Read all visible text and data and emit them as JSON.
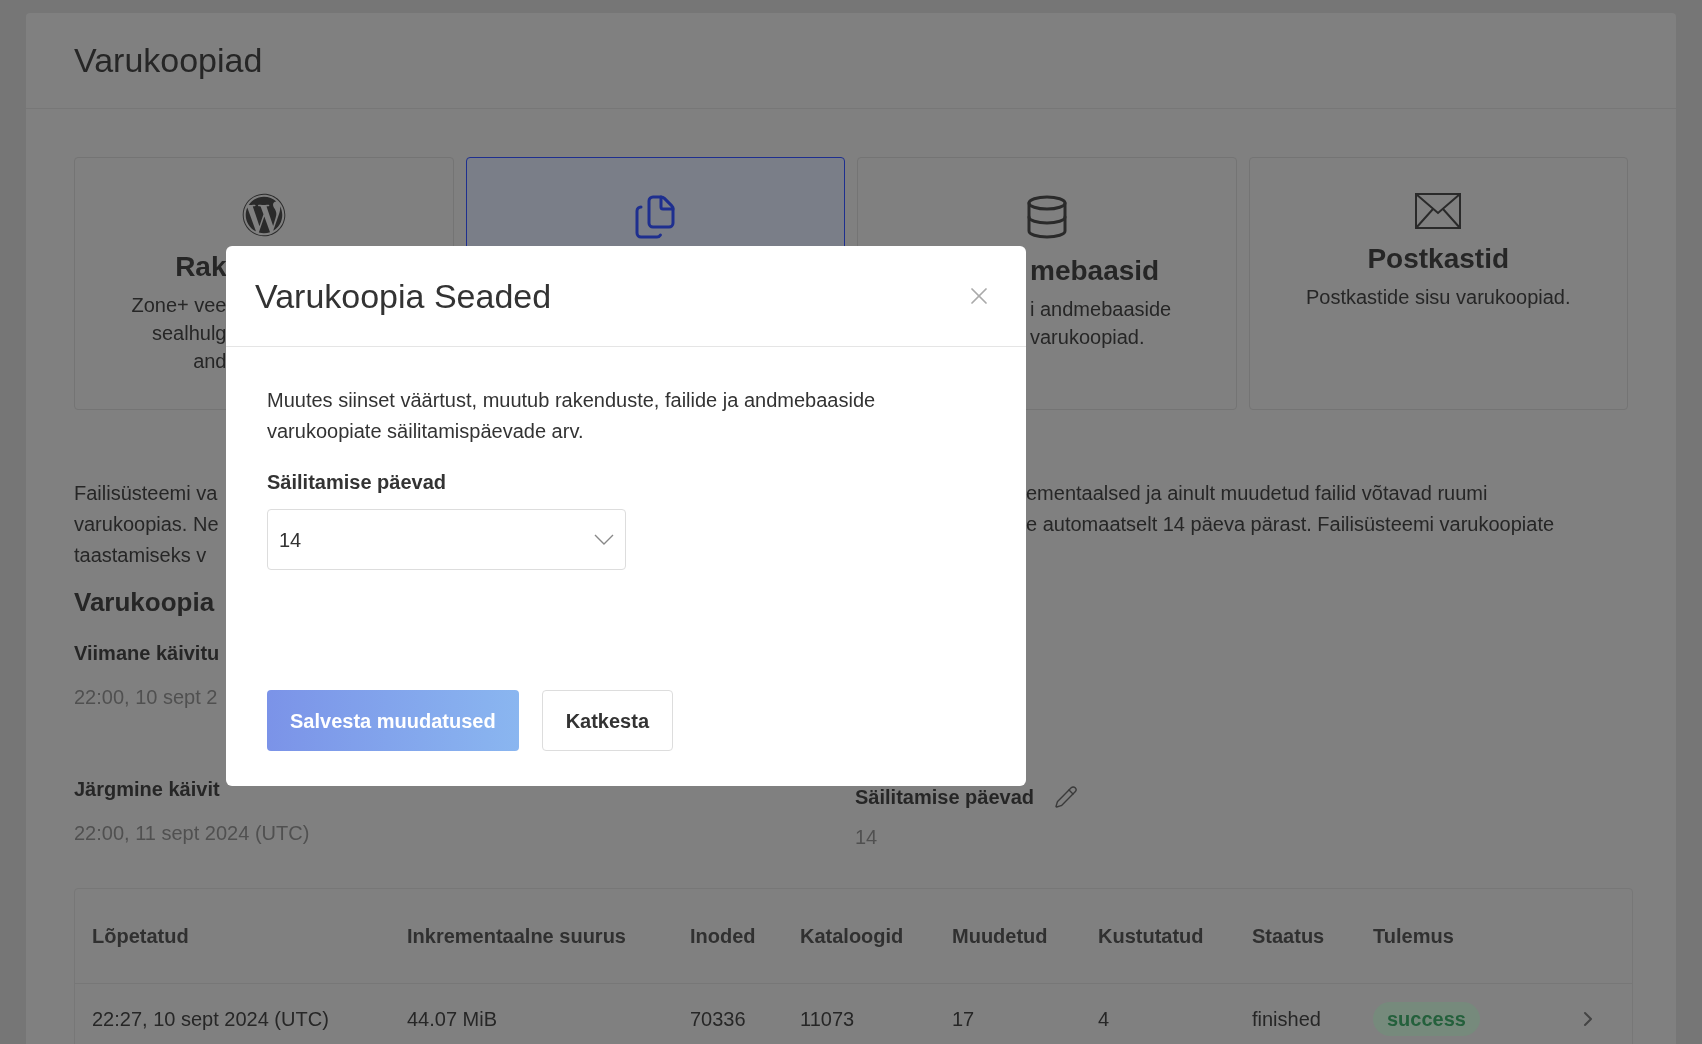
{
  "page": {
    "title": "Varukoopiad"
  },
  "cards": [
    {
      "kind": "partial-right",
      "selected": false,
      "title": "Rak",
      "lines": [
        "Zone+ vee",
        "sealhulg",
        "and"
      ]
    },
    {
      "kind": "hidden",
      "selected": true
    },
    {
      "kind": "partial-left",
      "selected": false,
      "title": "mebaasid",
      "lines": [
        "i andmebaaside",
        "varukoopiad."
      ]
    },
    {
      "kind": "full",
      "selected": false,
      "title": "Postkastid",
      "lines": [
        "Postkastide sisu varukoopiad."
      ]
    }
  ],
  "description": {
    "left_lines": [
      "Failisüsteemi va",
      "varukoopias. Ne",
      "taastamiseks v"
    ],
    "right_lines": [
      "ementaalsed ja ainult muudetud failid võtavad ruumi",
      "e automaatselt 14 päeva pärast. Failisüsteemi varukoopiate"
    ]
  },
  "section_title": "Varukoopia",
  "last_run": {
    "label": "Viimane käivitu",
    "value": "22:00, 10 sept 2"
  },
  "next_run": {
    "label": "Järgmine käivit",
    "value": "22:00, 11 sept 2024 (UTC)"
  },
  "retention": {
    "label": "Säilitamise päevad",
    "value": "14"
  },
  "table": {
    "columns": [
      "Lõpetatud",
      "Inkrementaalne suurus",
      "Inoded",
      "Kataloogid",
      "Muudetud",
      "Kustutatud",
      "Staatus",
      "Tulemus"
    ],
    "rows": [
      {
        "cells": [
          "22:27, 10 sept 2024 (UTC)",
          "44.07 MiB",
          "70336",
          "11073",
          "17",
          "4",
          "finished"
        ],
        "result": "success"
      }
    ]
  },
  "modal": {
    "title": "Varukoopia Seaded",
    "body": "Muutes siinset väärtust, muutub rakenduste, failide ja andmebaaside varukoopiate säilitamispäevade arv.",
    "field": {
      "label": "Säilitamise päevad",
      "value": "14"
    },
    "buttons": [
      {
        "label": "Salvesta muudatused",
        "kind": "primary"
      },
      {
        "label": "Katkesta",
        "kind": "secondary"
      }
    ]
  }
}
